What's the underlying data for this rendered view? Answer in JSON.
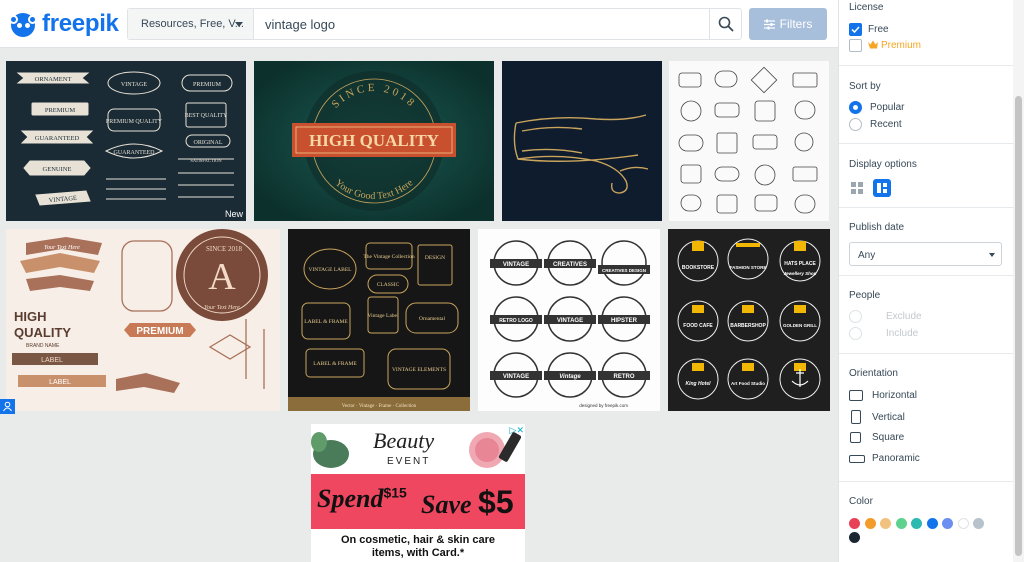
{
  "header": {
    "logo_text": "freepik",
    "search": {
      "type_label": "Resources, Free, V...",
      "query": "vintage logo"
    },
    "filters_label": "Filters"
  },
  "grid": {
    "tiles": [
      {
        "labels": [
          "ORNAMENT",
          "PREMIUM",
          "GUARANTEED",
          "GENUINE",
          "VINTAGE",
          "VINTAGE",
          "PREMIUM QUALITY",
          "GUARANTEED",
          "PREMIUM",
          "BEST QUALITY",
          "ORIGINAL",
          "SATISFACTION"
        ],
        "badge": "New"
      },
      {
        "labels": [
          "SINCE 2018",
          "HIGH QUALITY",
          "Your Good Text Here"
        ]
      },
      {
        "labels": []
      },
      {
        "labels": []
      },
      {
        "labels": [
          "Your Text Here",
          "HIGH",
          "QUALITY",
          "BRAND NAME",
          "LABEL",
          "LABEL",
          "SINCE 2018",
          "A",
          "Your Text Here",
          "PREMIUM"
        ]
      },
      {
        "labels": [
          "VINTAGE LABEL",
          "The Vintage Collection",
          "DESIGN",
          "CLASSIC",
          "LABEL & FRAME",
          "Vintage Label",
          "Ornamental",
          "LABEL & FRAME",
          "VINTAGE ELEMENTS",
          "Vector · Vintage · Frame · Collection"
        ]
      },
      {
        "labels": [
          "VINTAGE",
          "CREATIVES",
          "CREATIVES DESIGN",
          "RETRO LOGO",
          "VINTAGE",
          "HIPSTER",
          "VINTAGE",
          "Vintage",
          "RETRO",
          "designed by freepik.com"
        ]
      },
      {
        "labels": [
          "BOOKSTORE",
          "HATS PLACE",
          "FASHION STORE",
          "Jewellery Shop",
          "FOOD CAFE",
          "BARBERSHOP",
          "GOLDEN GRILL",
          "King Hotel",
          "Art Food Studio"
        ]
      }
    ]
  },
  "ad": {
    "adchoice": "▷✕",
    "brand_script": "Beauty",
    "brand_sub": "EVENT",
    "spend": "Spend",
    "spend_amount": "$15",
    "save": "Save",
    "save_amount": "$5",
    "desc_line1": "On cosmetic, hair & skin care",
    "desc_line2": "items, with Card.*"
  },
  "panel": {
    "license": {
      "title": "License",
      "free": "Free",
      "premium": "Premium"
    },
    "sort": {
      "title": "Sort by",
      "popular": "Popular",
      "recent": "Recent"
    },
    "display": {
      "title": "Display options"
    },
    "publish": {
      "title": "Publish date",
      "value": "Any"
    },
    "people": {
      "title": "People",
      "exclude": "Exclude",
      "include": "Include"
    },
    "orientation": {
      "title": "Orientation",
      "horizontal": "Horizontal",
      "vertical": "Vertical",
      "square": "Square",
      "panoramic": "Panoramic"
    },
    "color": {
      "title": "Color",
      "swatches": [
        "#e84057",
        "#f39c2c",
        "#f1c27d",
        "#5fd18f",
        "#2bb9b0",
        "#1273eb",
        "#6b8ef0",
        "#ffffff",
        "#b6c3cc",
        "#1c2630"
      ]
    }
  },
  "colors": {
    "brand": "#1273eb",
    "filters_button": "#a8bfdb",
    "ad_pink": "#ef4760"
  }
}
